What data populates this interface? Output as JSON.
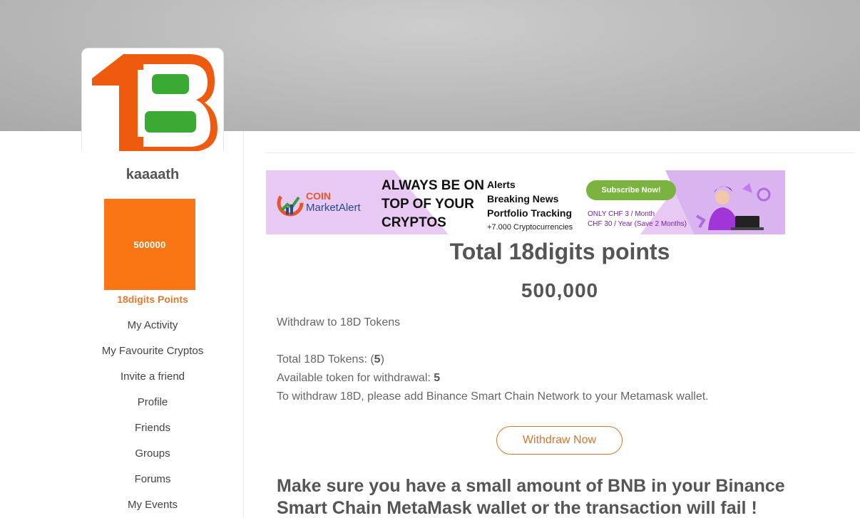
{
  "profile": {
    "username": "kaaaath",
    "points_tile": "500000"
  },
  "sidebar": {
    "items": [
      {
        "label": "18digits Points"
      },
      {
        "label": "My Activity"
      },
      {
        "label": "My Favourite Cryptos"
      },
      {
        "label": "Invite a friend"
      },
      {
        "label": "Profile"
      },
      {
        "label": "Friends"
      },
      {
        "label": "Groups"
      },
      {
        "label": "Forums"
      },
      {
        "label": "My Events"
      }
    ]
  },
  "banner": {
    "brand_line1": "COIN",
    "brand_line2": "MarketAlert",
    "headline": "ALWAYS BE ON TOP OF YOUR CRYPTOS",
    "features": [
      "Alerts",
      "Breaking News",
      "Portfolio Tracking"
    ],
    "features_note": "+7.000 Cryptocurrencies",
    "subscribe_label": "Subscribe Now!",
    "price_month": "ONLY CHF 3 / Month",
    "price_year": "CHF 30 / Year (Save 2 Months)"
  },
  "main": {
    "title": "Total 18digits points",
    "points": "500,000",
    "withdraw_heading": "Withdraw to 18D Tokens",
    "total_tokens_label": "Total 18D Tokens: (",
    "total_tokens_value": "5",
    "total_tokens_suffix": ")",
    "available_label": "Available token for withdrawal: ",
    "available_value": "5",
    "instruction": "To withdraw 18D, please add Binance Smart Chain Network to your Metamask wallet.",
    "withdraw_button": "Withdraw Now",
    "warning": "Make sure you have a small amount of BNB in your Binance Smart Chain MetaMask wallet or the transaction will fail !"
  },
  "colors": {
    "accent_orange": "#fa7513",
    "logo_green": "#3aaa35",
    "button_border": "#d9742a"
  }
}
